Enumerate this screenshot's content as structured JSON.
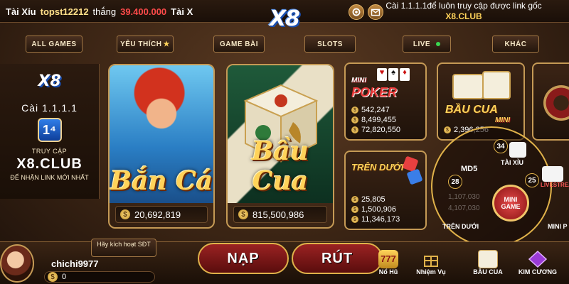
{
  "ticker": {
    "game": "Tài Xỉu",
    "player": "topst12212",
    "verb": "thắng",
    "amount": "39.400.000",
    "next_game": "Tài X"
  },
  "notice": {
    "text": "Cài 1.1.1.1để luôn truy cập được link gốc",
    "site": "X8.CLUB"
  },
  "logo": "X8",
  "tabs": {
    "all_games": "ALL GAMES",
    "favorites": "YÊU THÍCH",
    "card_games": "GAME BÀI",
    "slots": "SLOTS",
    "live": "LIVE",
    "other": "KHÁC"
  },
  "promo": {
    "logo": "X8",
    "version": "Cài 1.1.1.1",
    "badge": "1⁴",
    "access": "TRUY CẬP",
    "domain": "X8.CLUB",
    "tagline": "ĐỂ NHẬN LINK MỚI NHẤT"
  },
  "cards": {
    "ban_ca": {
      "title": "Bắn Cá",
      "jackpot": "20,692,819"
    },
    "bau_cua": {
      "title": "Bầu Cua",
      "jackpot": "815,500,986"
    }
  },
  "small_cards": {
    "mini_poker": {
      "title_top": "MINI",
      "title": "POKER",
      "values": [
        "542,247",
        "8,499,455",
        "72,820,550"
      ]
    },
    "bau_cua_mini": {
      "title": "BẦU CUA",
      "sub": "MINI",
      "values": [
        "2,396,256"
      ]
    },
    "tren_duoi": {
      "title": "TRÊN DƯỚI",
      "values": [
        "25,805",
        "1,500,906",
        "11,346,173"
      ]
    }
  },
  "mini_game": {
    "center": [
      "MINI",
      "GAME"
    ],
    "items": [
      {
        "num": "34",
        "label": "TÀI XỈU"
      },
      {
        "num": "28",
        "label": "MD5"
      },
      {
        "num": "25",
        "label": "LIVESTREAM"
      }
    ],
    "tren_duoi_label": "TRÊN DƯỚI",
    "mini_partial": "MINI P",
    "faded_values": [
      "1,107,030",
      "4,107,030"
    ]
  },
  "user": {
    "hint": "Hãy kích hoạt SĐT",
    "name": "chichi9977",
    "balance": "0"
  },
  "buttons": {
    "deposit": "NẠP",
    "withdraw": "RÚT"
  },
  "nav": {
    "nohu": "Nổ Hũ",
    "mission": "Nhiệm Vụ",
    "bau_cua": "BẦU CUA",
    "kim_cuong": "KIM CƯƠNG"
  },
  "colors": {
    "gold": "#ffd35a",
    "border": "#c59a55",
    "win_amount": "#ff4a4a",
    "live_dot": "#3ad650"
  }
}
